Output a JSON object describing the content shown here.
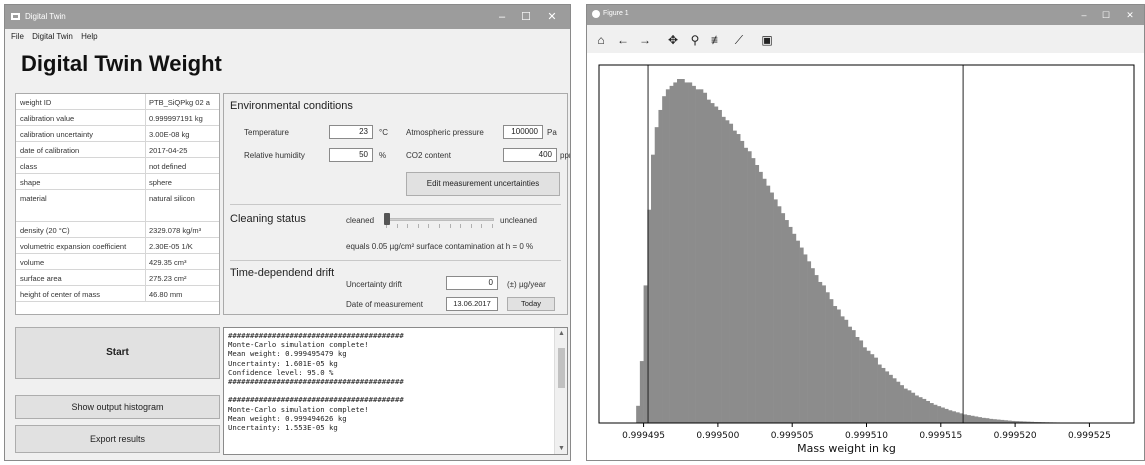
{
  "main_window": {
    "title": "Digital Twin",
    "menu": [
      "File",
      "Digital Twin",
      "Help"
    ],
    "heading": "Digital Twin Weight",
    "properties": [
      {
        "key": "weight ID",
        "value": "PTB_SiQPkg 02 a"
      },
      {
        "key": "calibration value",
        "value": "0.999997191 kg"
      },
      {
        "key": "calibration uncertainty",
        "value": "3.00E-08 kg"
      },
      {
        "key": "date of calibration",
        "value": "2017-04-25"
      },
      {
        "key": "class",
        "value": "not defined"
      },
      {
        "key": "shape",
        "value": "sphere"
      },
      {
        "key": "material",
        "value": "natural silicon"
      },
      {
        "key": "",
        "value": ""
      },
      {
        "key": "density (20 °C)",
        "value": "2329.078 kg/m³"
      },
      {
        "key": "volumetric expansion coefficient",
        "value": "2.30E-05 1/K"
      },
      {
        "key": "volume",
        "value": "429.35 cm³"
      },
      {
        "key": "surface area",
        "value": "275.23 cm²"
      },
      {
        "key": "height of center of mass",
        "value": "46.80 mm"
      }
    ],
    "env": {
      "section": "Environmental conditions",
      "temperature_label": "Temperature",
      "temperature_value": "23",
      "temperature_unit": "°C",
      "humidity_label": "Relative humidity",
      "humidity_value": "50",
      "humidity_unit": "%",
      "pressure_label": "Atmospheric pressure",
      "pressure_value": "100000",
      "pressure_unit": "Pa",
      "co2_label": "CO2 content",
      "co2_value": "400",
      "co2_unit": "ppm",
      "edit_button": "Edit measurement uncertainties"
    },
    "cleaning": {
      "section": "Cleaning status",
      "left_label": "cleaned",
      "right_label": "uncleaned",
      "slider_level": 0,
      "description": "equals 0.05 µg/cm² surface contamination at h = 0 %"
    },
    "drift": {
      "section": "Time-dependend drift",
      "uncertainty_label": "Uncertainty drift",
      "uncertainty_value": "0",
      "uncertainty_unit": "(±) µg/year",
      "date_label": "Date of measurement",
      "date_value": "13.06.2017",
      "today_button": "Today"
    },
    "buttons": {
      "start": "Start",
      "histogram": "Show output histogram",
      "export": "Export results"
    },
    "log_lines": [
      "########################################",
      "Monte-Carlo simulation complete!",
      "Mean weight: 0.999495479 kg",
      "Uncertainty: 1.601E-05 kg",
      "Confidence level: 95.0 %",
      "########################################",
      "",
      "########################################",
      "Monte-Carlo simulation complete!",
      "Mean weight: 0.999494626 kg",
      "Uncertainty: 1.553E-05 kg"
    ]
  },
  "figure_window": {
    "title": "Figure 1",
    "toolbar_icons": [
      "home-icon",
      "back-icon",
      "forward-icon",
      "pan-icon",
      "zoom-icon",
      "configure-icon",
      "edit-curve-icon",
      "save-icon"
    ]
  },
  "chart_data": {
    "type": "bar",
    "xlabel": "Mass weight in kg",
    "ylabel": "",
    "title": "",
    "x_ticks": [
      "0.999495",
      "0.999500",
      "0.999505",
      "0.999510",
      "0.999515",
      "0.999520",
      "0.999525",
      "0.9995"
    ],
    "xlim": [
      0.999492,
      0.999528
    ],
    "vlines": [
      0.9994953,
      0.9995165
    ],
    "bin_start": 0.9994945,
    "bin_width": 2.5e-07,
    "bin_color": "#8c8c8c",
    "counts": [
      5,
      18,
      40,
      62,
      78,
      86,
      91,
      95,
      97,
      98,
      99,
      100,
      100,
      99,
      99,
      98,
      97,
      97,
      96,
      94,
      93,
      92,
      91,
      89,
      88,
      87,
      85,
      84,
      82,
      80,
      79,
      77,
      75,
      73,
      71,
      69,
      67,
      65,
      63,
      61,
      59,
      57,
      55,
      53,
      51,
      49,
      47,
      45,
      43,
      41,
      40,
      38,
      36,
      34,
      33,
      31,
      30,
      28,
      27,
      25,
      24,
      22,
      21,
      20,
      19,
      17,
      16,
      15,
      14,
      13,
      12,
      11,
      10,
      9.5,
      8.8,
      8,
      7.5,
      7,
      6.4,
      5.8,
      5.3,
      4.9,
      4.5,
      4.1,
      3.7,
      3.4,
      3.1,
      2.8,
      2.5,
      2.3,
      2.1,
      1.9,
      1.7,
      1.5,
      1.4,
      1.2,
      1.1,
      1.0,
      0.9,
      0.8,
      0.7,
      0.6,
      0.55,
      0.5,
      0.45,
      0.4,
      0.35,
      0.3,
      0.28,
      0.25,
      0.22,
      0.2,
      0.18,
      0.16,
      0.14,
      0.12,
      0.1,
      0.09,
      0.08,
      0.07,
      0.06,
      0.05,
      0.04,
      0.03
    ]
  }
}
